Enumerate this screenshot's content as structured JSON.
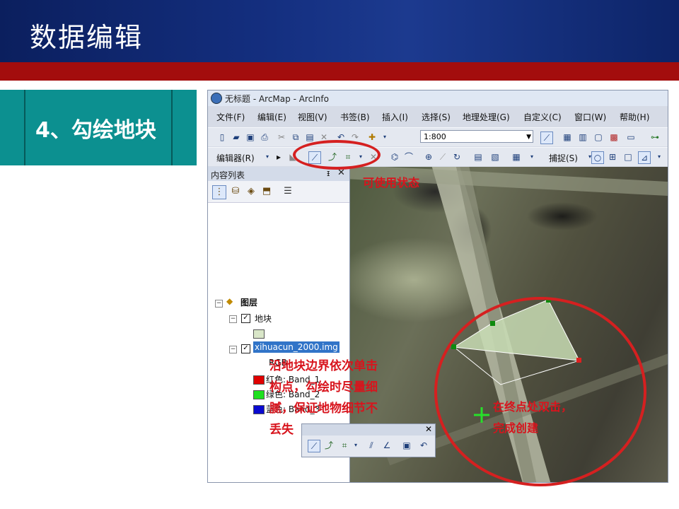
{
  "slide": {
    "title": "数据编辑",
    "section_label": "4、勾绘地块"
  },
  "window": {
    "title": "无标题 - ArcMap - ArcInfo",
    "menu": [
      "文件(F)",
      "编辑(E)",
      "视图(V)",
      "书签(B)",
      "插入(I)",
      "选择(S)",
      "地理处理(G)",
      "自定义(C)",
      "窗口(W)",
      "帮助(H)"
    ],
    "scale_value": "1:800",
    "editor_label": "编辑器(R)",
    "snapping_label": "捕捉(S)"
  },
  "toc": {
    "header": "内容列表",
    "pin_glyph": "ᵻ",
    "close_glyph": "✕",
    "root": "图层",
    "layer1": "地块",
    "layer2": "xihuacun_2000.img",
    "rgb": "RGB",
    "bands": [
      {
        "label": "红色:   Band_1",
        "color": "#e00000"
      },
      {
        "label": "绿色: Band_2",
        "color": "#1ee01e"
      },
      {
        "label": "蓝色:   Band_3",
        "color": "#0a0ad0"
      }
    ]
  },
  "annotations": {
    "available": "可使用状态",
    "instruction": [
      "沿地块边界依次单击",
      "构点，勾绘时尽量细",
      "腻，保证地物细节不",
      "丢失"
    ],
    "finish": [
      "在终点处双击，",
      "完成创建"
    ]
  },
  "colors": {
    "header_bg": "#142f80",
    "accent_red": "#a30d0d",
    "teal": "#0c9090",
    "annotation_red": "#d8141d",
    "polygon_fill": "#c8dcb4"
  }
}
